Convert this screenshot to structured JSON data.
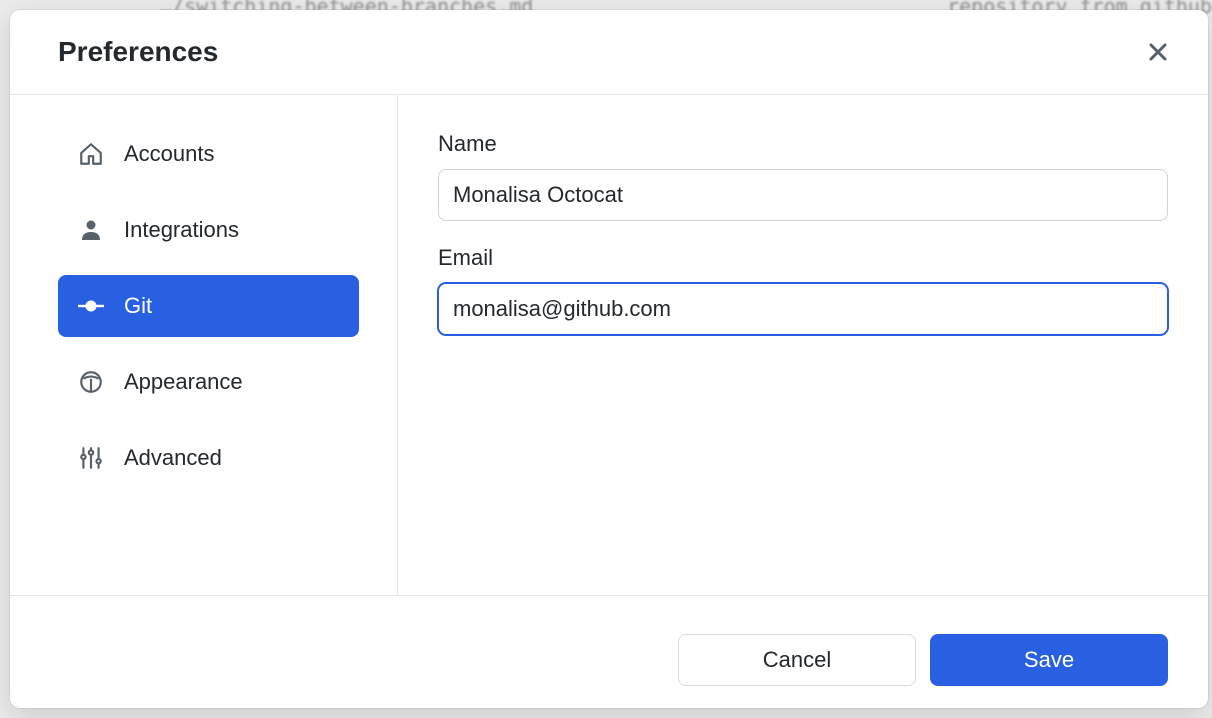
{
  "modal": {
    "title": "Preferences"
  },
  "sidebar": {
    "items": [
      {
        "label": "Accounts"
      },
      {
        "label": "Integrations"
      },
      {
        "label": "Git"
      },
      {
        "label": "Appearance"
      },
      {
        "label": "Advanced"
      }
    ],
    "active_index": 2
  },
  "form": {
    "name_label": "Name",
    "name_value": "Monalisa Octocat",
    "email_label": "Email",
    "email_value": "monalisa@github.com"
  },
  "footer": {
    "cancel_label": "Cancel",
    "save_label": "Save"
  },
  "colors": {
    "accent": "#2860e1"
  }
}
